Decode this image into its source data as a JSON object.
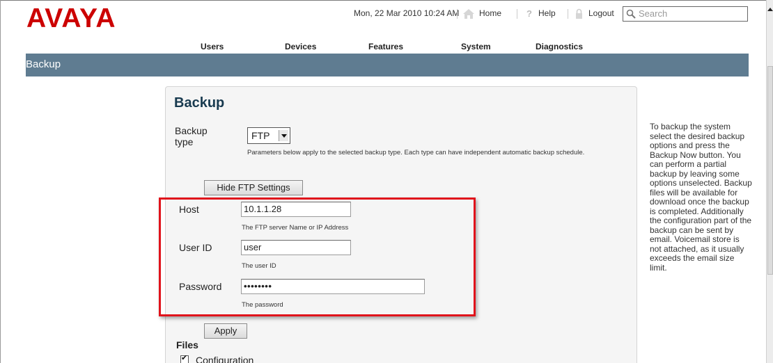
{
  "header": {
    "logo": "AVAYA",
    "datetime": "Mon, 22 Mar 2010 10:24 AM",
    "home_label": "Home",
    "help_label": "Help",
    "logout_label": "Logout",
    "search_placeholder": "Search"
  },
  "nav": {
    "items": [
      "Users",
      "Devices",
      "Features",
      "System",
      "Diagnostics"
    ]
  },
  "page": {
    "title_bar": "Backup",
    "heading": "Backup"
  },
  "form": {
    "backup_type_label": "Backup type",
    "backup_type_value": "FTP",
    "backup_type_note": "Parameters below apply to the selected backup type. Each type can have independent automatic backup schedule.",
    "hide_settings_button": "Hide FTP Settings",
    "host_label": "Host",
    "host_value": "10.1.1.28",
    "host_note": "The FTP server Name or IP Address",
    "userid_label": "User ID",
    "userid_value": "user",
    "userid_note": "The user ID",
    "password_label": "Password",
    "password_value": "••••••••",
    "password_note": "The password",
    "apply_button": "Apply",
    "files_heading": "Files",
    "files_option_configuration": "Configuration",
    "files_option_configuration_checked": true
  },
  "help_text": "To backup the system select the desired backup options and press the Backup Now button. You can perform a partial backup by leaving some options unselected. Backup files will be available for download once the backup is completed. Additionally the configuration part of the backup can be sent by email. Voicemail store is not attached, as it usually exceeds the email size limit.",
  "colors": {
    "brand": "#cc0000",
    "title_bar": "#5f7c91",
    "highlight_box": "#e0131b"
  }
}
